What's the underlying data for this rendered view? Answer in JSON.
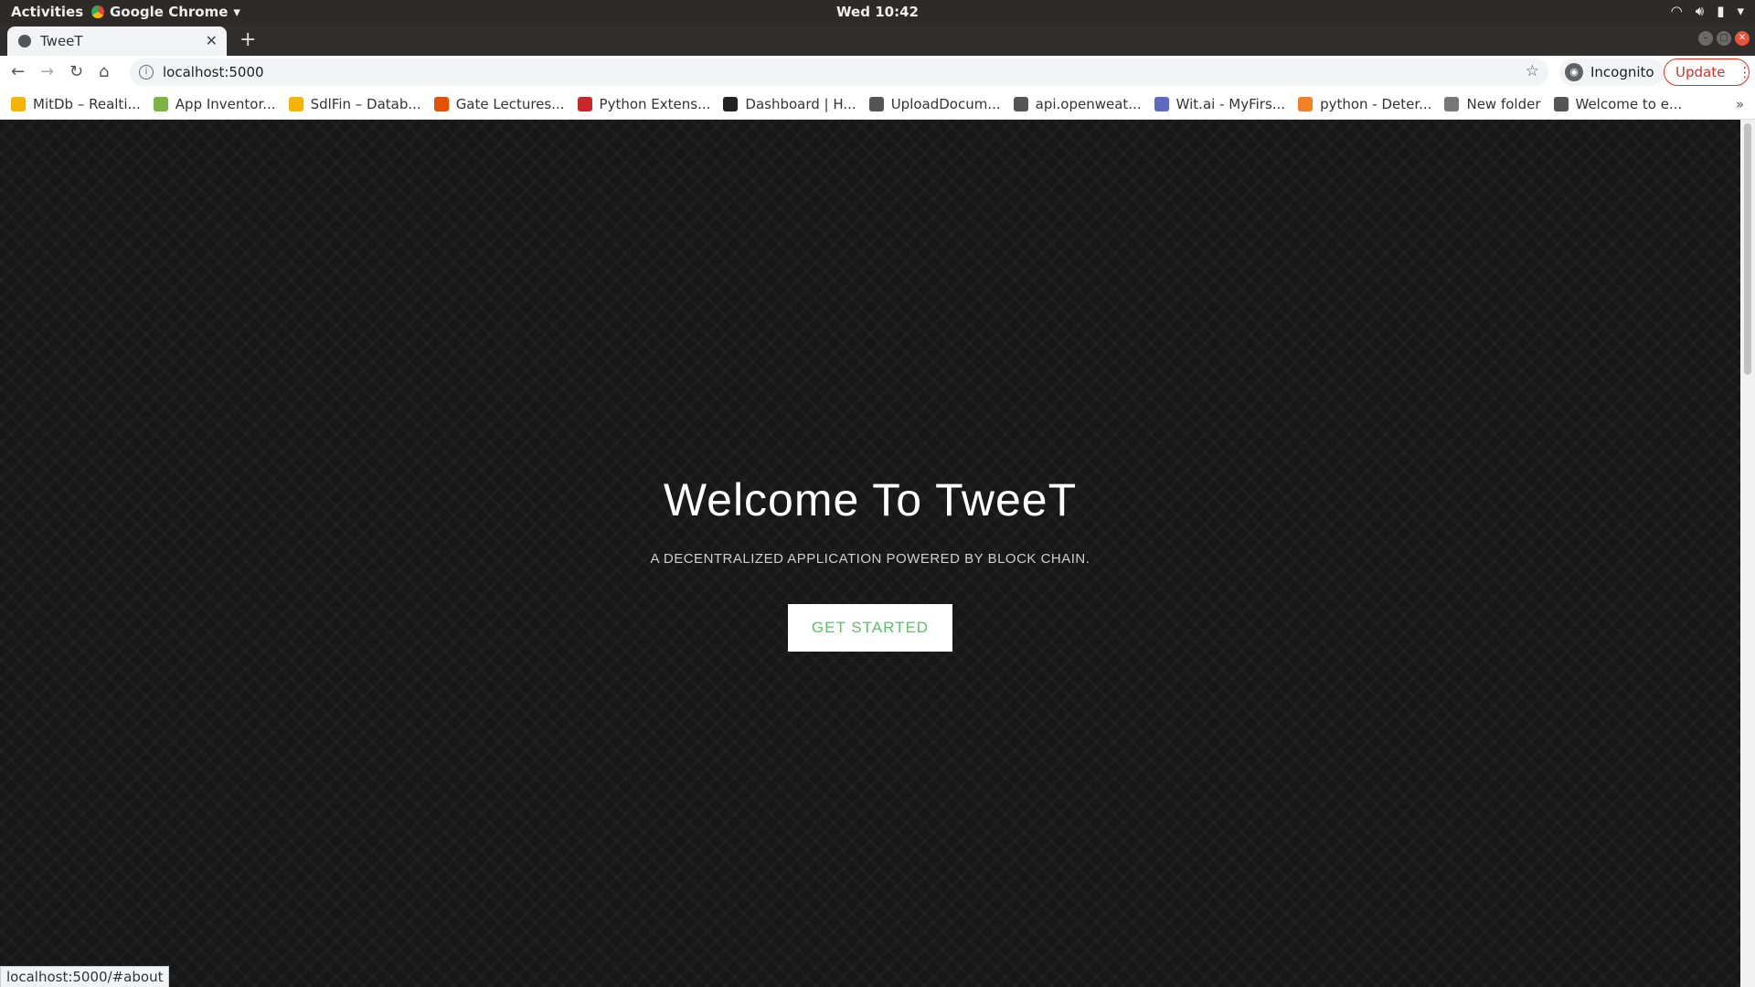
{
  "system": {
    "activities": "Activities",
    "app_name": "Google Chrome",
    "clock": "Wed 10:42"
  },
  "browser": {
    "tab_title": "TweeT",
    "url": "localhost:5000",
    "incognito_label": "Incognito",
    "update_label": "Update",
    "bookmarks": [
      {
        "label": "MitDb – Realti...",
        "color": "#f4b400"
      },
      {
        "label": "App Inventor...",
        "color": "#7cb342"
      },
      {
        "label": "SdlFin – Datab...",
        "color": "#f4b400"
      },
      {
        "label": "Gate Lectures...",
        "color": "#e65100"
      },
      {
        "label": "Python Extens...",
        "color": "#c62828"
      },
      {
        "label": "Dashboard | H...",
        "color": "#222222"
      },
      {
        "label": "UploadDocum...",
        "color": "#555555"
      },
      {
        "label": "api.openweat...",
        "color": "#555555"
      },
      {
        "label": "Wit.ai - MyFirs...",
        "color": "#5c6bc0"
      },
      {
        "label": "python - Deter...",
        "color": "#f48024"
      },
      {
        "label": "New folder",
        "color": "#777777"
      },
      {
        "label": "Welcome to e...",
        "color": "#555555"
      }
    ],
    "status_url": "localhost:5000/#about"
  },
  "hero": {
    "title": "Welcome To TweeT",
    "subtitle": "A DECENTRALIZED APPLICATION POWERED BY BLOCK CHAIN.",
    "cta_label": "GET STARTED"
  }
}
